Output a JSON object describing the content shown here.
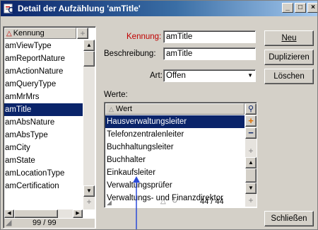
{
  "window": {
    "title": "Detail der Aufzählung 'amTitle'"
  },
  "titlebar_buttons": {
    "minimize": "_",
    "maximize": "□",
    "close": "×"
  },
  "left_list": {
    "header": "Kennung",
    "items": [
      "amViewType",
      "amReportNature",
      "amActionNature",
      "amQueryType",
      "amMrMrs",
      "amTitle",
      "amAbsNature",
      "amAbsType",
      "amCity",
      "amState",
      "amLocationType",
      "amCertification"
    ],
    "selected": "amTitle",
    "footer_count": "99 / 99"
  },
  "form": {
    "kennung_label": "Kennung:",
    "kennung_value": "amTitle",
    "beschreibung_label": "Beschreibung:",
    "beschreibung_value": "amTitle",
    "art_label": "Art:",
    "art_value": "Offen",
    "werte_label": "Werte:"
  },
  "werte_list": {
    "header": "Wert",
    "items": [
      "Hausverwaltungsleiter",
      "Telefonzentralenleiter",
      "Buchhaltungsleiter",
      "Buchhalter",
      "Einkaufsleiter",
      "Verwaltungsprüfer",
      "Verwaltungs- und Finanzdirektor"
    ],
    "selected": "Hausverwaltungsleiter",
    "footer_count": "44 / 44"
  },
  "buttons": {
    "neu": "Neu",
    "duplizieren": "Duplizieren",
    "loeschen": "Löschen",
    "schliessen": "Schließen"
  },
  "colors": {
    "selection": "#0a246a",
    "kennung_label": "#c00000",
    "dialog": "#d4d0c8"
  }
}
